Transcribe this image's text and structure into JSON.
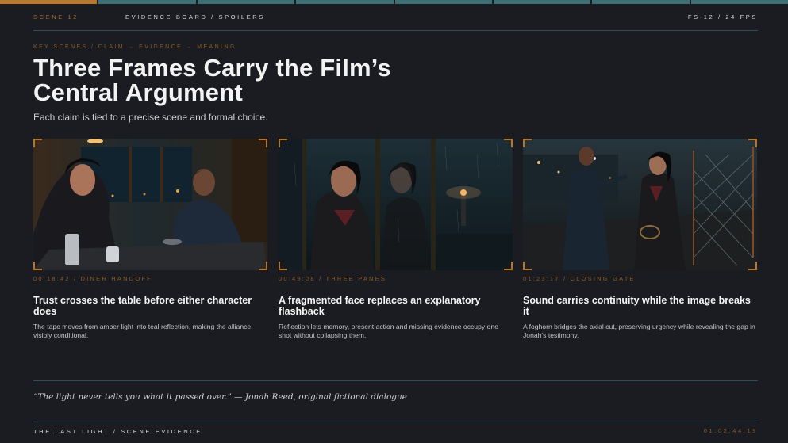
{
  "progress": {
    "segments": 8,
    "active_index": 0
  },
  "topbar": {
    "scene": "SCENE 12",
    "board": "EVIDENCE BOARD / SPOILERS",
    "fps": "FS-12 / 24 FPS"
  },
  "header": {
    "kicker": "KEY SCENES / CLAIM → EVIDENCE → MEANING",
    "title": "Three Frames Carry the Film’s Central Argument",
    "subtitle": "Each claim is tied to a precise scene and formal choice."
  },
  "cards": [
    {
      "timecode": "00:18:42 / DINER HANDOFF",
      "heading": "Trust crosses the table before either character does",
      "body": "The tape moves from amber light into teal reflection, making the alliance visibly conditional.",
      "image": "diner-booth-still"
    },
    {
      "timecode": "00:49:08 / THREE PANES",
      "heading": "A fragmented face replaces an explanatory flashback",
      "body": "Reflection lets memory, present action and missing evidence occupy one shot without collapsing them.",
      "image": "window-reflection-still"
    },
    {
      "timecode": "01:23:17 / CLOSING GATE",
      "heading": "Sound carries continuity while the image breaks it",
      "body": "A foghorn bridges the axial cut, preserving urgency while revealing the gap in Jonah’s testimony.",
      "image": "pier-gate-still"
    }
  ],
  "quote": "“The light never tells you what it passed over.” — Jonah Reed, original fictional dialogue",
  "footer": {
    "left": "THE LAST LIGHT / SCENE EVIDENCE",
    "right": "01:02:44:19"
  },
  "colors": {
    "background": "#1b1c21",
    "accent_amber": "#b3762c",
    "accent_teal": "#3f6e74"
  }
}
